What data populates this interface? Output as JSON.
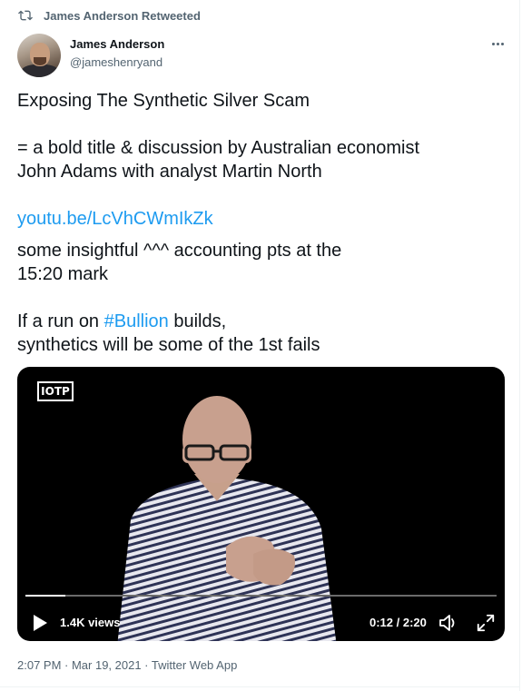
{
  "retweet": {
    "label": "James Anderson Retweeted"
  },
  "author": {
    "name": "James Anderson",
    "handle": "@jameshenryand"
  },
  "tweet": {
    "line1": "Exposing The Synthetic Silver Scam",
    "line2": "= a bold title & discussion by Australian economist",
    "line3": "John Adams with analyst Martin North",
    "link": "youtu.be/LcVhCWmIkZk",
    "line4": "some insightful ^^^ accounting pts at the",
    "line5": "15:20 mark",
    "line6_prefix": "If a run on ",
    "hashtag": "#Bullion",
    "line6_suffix": " builds,",
    "line7": "synthetics will be some of the 1st fails"
  },
  "video": {
    "logo_text": "IOTP",
    "views": "1.4K views",
    "time": "0:12 / 2:20",
    "progress": 0.0857
  },
  "meta": {
    "text": "2:07 PM · Mar 19, 2021 · Twitter Web App"
  },
  "colors": {
    "accent": "#1d9bf0",
    "secondary_text": "#536471",
    "primary_text": "#0f1419",
    "video_bg": "#000000"
  },
  "icons": [
    "retweet-icon",
    "more-icon",
    "play-icon",
    "volume-icon",
    "fullscreen-icon"
  ]
}
